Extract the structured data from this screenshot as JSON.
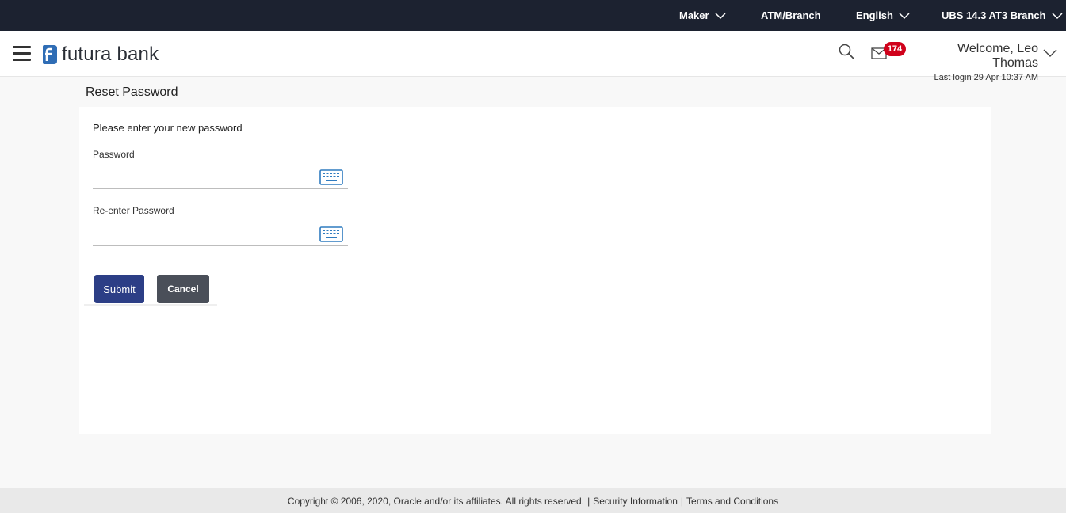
{
  "topbar": {
    "role": "Maker",
    "entity": "ATM/Branch",
    "language": "English",
    "system": "UBS 14.3 AT3 Branch"
  },
  "header": {
    "brand": "futura bank",
    "notification_count": "174",
    "welcome": "Welcome, Leo Thomas",
    "last_login": "Last login 29 Apr 10:37 AM"
  },
  "page": {
    "title": "Reset Password",
    "instruction": "Please enter your new password",
    "password_label": "Password",
    "password_value": "",
    "reenter_label": "Re-enter Password",
    "reenter_value": "",
    "submit_label": "Submit",
    "cancel_label": "Cancel"
  },
  "footer": {
    "copyright": "Copyright © 2006, 2020, Oracle and/or its affiliates. All rights reserved.",
    "security": "Security Information",
    "terms": "Terms and Conditions"
  },
  "colors": {
    "topbar_bg": "#1c2230",
    "submit_bg": "#2c3e86",
    "cancel_bg": "#4a4f59",
    "badge_bg": "#d0021b",
    "keyboard_icon": "#2f7bbf"
  },
  "icons": [
    "hamburger-icon",
    "futura-logo-icon",
    "search-icon",
    "mail-icon",
    "chevron-down-icon",
    "virtual-keyboard-icon"
  ]
}
